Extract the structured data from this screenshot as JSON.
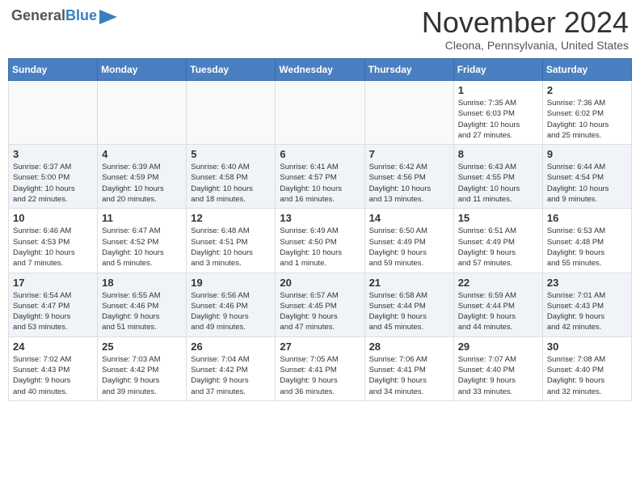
{
  "header": {
    "logo_general": "General",
    "logo_blue": "Blue",
    "month_title": "November 2024",
    "location": "Cleona, Pennsylvania, United States"
  },
  "weekdays": [
    "Sunday",
    "Monday",
    "Tuesday",
    "Wednesday",
    "Thursday",
    "Friday",
    "Saturday"
  ],
  "weeks": [
    [
      {
        "day": "",
        "info": ""
      },
      {
        "day": "",
        "info": ""
      },
      {
        "day": "",
        "info": ""
      },
      {
        "day": "",
        "info": ""
      },
      {
        "day": "",
        "info": ""
      },
      {
        "day": "1",
        "info": "Sunrise: 7:35 AM\nSunset: 6:03 PM\nDaylight: 10 hours\nand 27 minutes."
      },
      {
        "day": "2",
        "info": "Sunrise: 7:36 AM\nSunset: 6:02 PM\nDaylight: 10 hours\nand 25 minutes."
      }
    ],
    [
      {
        "day": "3",
        "info": "Sunrise: 6:37 AM\nSunset: 5:00 PM\nDaylight: 10 hours\nand 22 minutes."
      },
      {
        "day": "4",
        "info": "Sunrise: 6:39 AM\nSunset: 4:59 PM\nDaylight: 10 hours\nand 20 minutes."
      },
      {
        "day": "5",
        "info": "Sunrise: 6:40 AM\nSunset: 4:58 PM\nDaylight: 10 hours\nand 18 minutes."
      },
      {
        "day": "6",
        "info": "Sunrise: 6:41 AM\nSunset: 4:57 PM\nDaylight: 10 hours\nand 16 minutes."
      },
      {
        "day": "7",
        "info": "Sunrise: 6:42 AM\nSunset: 4:56 PM\nDaylight: 10 hours\nand 13 minutes."
      },
      {
        "day": "8",
        "info": "Sunrise: 6:43 AM\nSunset: 4:55 PM\nDaylight: 10 hours\nand 11 minutes."
      },
      {
        "day": "9",
        "info": "Sunrise: 6:44 AM\nSunset: 4:54 PM\nDaylight: 10 hours\nand 9 minutes."
      }
    ],
    [
      {
        "day": "10",
        "info": "Sunrise: 6:46 AM\nSunset: 4:53 PM\nDaylight: 10 hours\nand 7 minutes."
      },
      {
        "day": "11",
        "info": "Sunrise: 6:47 AM\nSunset: 4:52 PM\nDaylight: 10 hours\nand 5 minutes."
      },
      {
        "day": "12",
        "info": "Sunrise: 6:48 AM\nSunset: 4:51 PM\nDaylight: 10 hours\nand 3 minutes."
      },
      {
        "day": "13",
        "info": "Sunrise: 6:49 AM\nSunset: 4:50 PM\nDaylight: 10 hours\nand 1 minute."
      },
      {
        "day": "14",
        "info": "Sunrise: 6:50 AM\nSunset: 4:49 PM\nDaylight: 9 hours\nand 59 minutes."
      },
      {
        "day": "15",
        "info": "Sunrise: 6:51 AM\nSunset: 4:49 PM\nDaylight: 9 hours\nand 57 minutes."
      },
      {
        "day": "16",
        "info": "Sunrise: 6:53 AM\nSunset: 4:48 PM\nDaylight: 9 hours\nand 55 minutes."
      }
    ],
    [
      {
        "day": "17",
        "info": "Sunrise: 6:54 AM\nSunset: 4:47 PM\nDaylight: 9 hours\nand 53 minutes."
      },
      {
        "day": "18",
        "info": "Sunrise: 6:55 AM\nSunset: 4:46 PM\nDaylight: 9 hours\nand 51 minutes."
      },
      {
        "day": "19",
        "info": "Sunrise: 6:56 AM\nSunset: 4:46 PM\nDaylight: 9 hours\nand 49 minutes."
      },
      {
        "day": "20",
        "info": "Sunrise: 6:57 AM\nSunset: 4:45 PM\nDaylight: 9 hours\nand 47 minutes."
      },
      {
        "day": "21",
        "info": "Sunrise: 6:58 AM\nSunset: 4:44 PM\nDaylight: 9 hours\nand 45 minutes."
      },
      {
        "day": "22",
        "info": "Sunrise: 6:59 AM\nSunset: 4:44 PM\nDaylight: 9 hours\nand 44 minutes."
      },
      {
        "day": "23",
        "info": "Sunrise: 7:01 AM\nSunset: 4:43 PM\nDaylight: 9 hours\nand 42 minutes."
      }
    ],
    [
      {
        "day": "24",
        "info": "Sunrise: 7:02 AM\nSunset: 4:43 PM\nDaylight: 9 hours\nand 40 minutes."
      },
      {
        "day": "25",
        "info": "Sunrise: 7:03 AM\nSunset: 4:42 PM\nDaylight: 9 hours\nand 39 minutes."
      },
      {
        "day": "26",
        "info": "Sunrise: 7:04 AM\nSunset: 4:42 PM\nDaylight: 9 hours\nand 37 minutes."
      },
      {
        "day": "27",
        "info": "Sunrise: 7:05 AM\nSunset: 4:41 PM\nDaylight: 9 hours\nand 36 minutes."
      },
      {
        "day": "28",
        "info": "Sunrise: 7:06 AM\nSunset: 4:41 PM\nDaylight: 9 hours\nand 34 minutes."
      },
      {
        "day": "29",
        "info": "Sunrise: 7:07 AM\nSunset: 4:40 PM\nDaylight: 9 hours\nand 33 minutes."
      },
      {
        "day": "30",
        "info": "Sunrise: 7:08 AM\nSunset: 4:40 PM\nDaylight: 9 hours\nand 32 minutes."
      }
    ]
  ]
}
